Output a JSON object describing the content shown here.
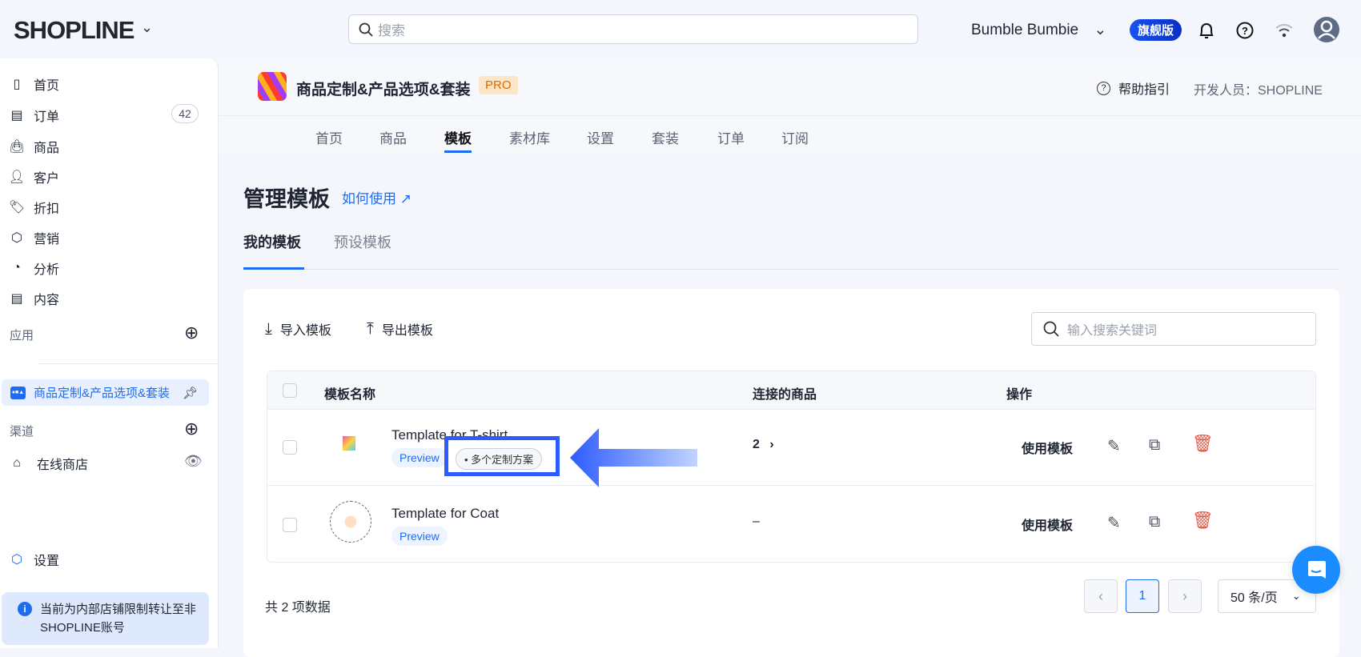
{
  "topbar": {
    "logo": "SHOPLINE",
    "search_placeholder": "搜索",
    "store": "Bumble Bumbie",
    "plan": "旗舰版"
  },
  "sidebar": {
    "items": [
      {
        "label": "首页"
      },
      {
        "label": "订单",
        "badge": "42"
      },
      {
        "label": "商品"
      },
      {
        "label": "客户"
      },
      {
        "label": "折扣"
      },
      {
        "label": "营销"
      },
      {
        "label": "分析"
      },
      {
        "label": "内容"
      }
    ],
    "apps_label": "应用",
    "app_item": "商品定制&产品选项&套装",
    "channels_label": "渠道",
    "online_store": "在线商店",
    "settings": "设置",
    "notice": "当前为内部店铺限制转让至非SHOPLINE账号"
  },
  "app": {
    "title": "商品定制&产品选项&套装",
    "pro": "PRO",
    "help": "帮助指引",
    "developer": "开发人员：SHOPLINE",
    "tabs": [
      "首页",
      "商品",
      "模板",
      "素材库",
      "设置",
      "套装",
      "订单",
      "订阅"
    ]
  },
  "page": {
    "title": "管理模板",
    "how_to": "如何使用",
    "subtabs": [
      "我的模板",
      "预设模板"
    ],
    "import": "导入模板",
    "export": "导出模板",
    "search_placeholder": "输入搜索关键词",
    "columns": [
      "模板名称",
      "连接的商品",
      "操作"
    ],
    "rows": [
      {
        "name": "Template for T-shirt",
        "preview": "Preview",
        "tag": "多个定制方案",
        "linked": "2",
        "use": "使用模板"
      },
      {
        "name": "Template for Coat",
        "preview": "Preview",
        "linked": "–",
        "use": "使用模板"
      }
    ],
    "total": "共 2 项数据",
    "page": "1",
    "page_size": "50 条/页"
  },
  "colors": {
    "accent": "#1d6cf2",
    "danger": "#f04d3a",
    "highlight": "#2d5bff"
  }
}
